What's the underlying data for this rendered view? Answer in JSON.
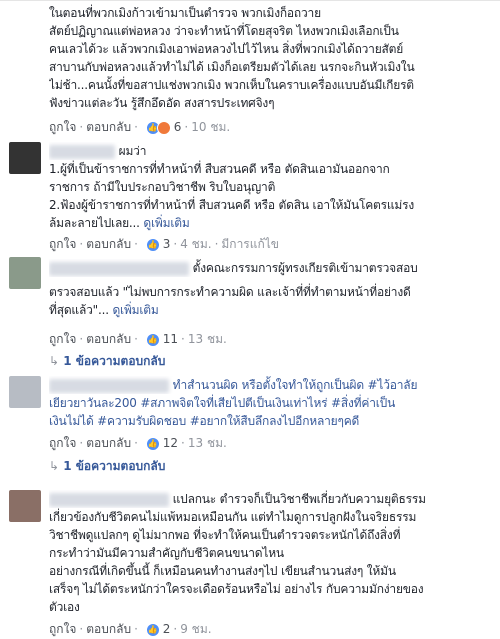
{
  "comments": [
    {
      "lines": [
        "ในตอนที่พวกเมิงก้าวเข้ามาเป็นตำรวจ พวกเมิงก็อถวาย",
        "สัตย์ปฏิญาณแต่พ่อหลวง ว่าจะทำหน้าที่โดยสุจริต ไหงพวกเมิงเลือกเป็น",
        "คนเลวได้วะ แล้วพวกเมิงเอาพ่อหลวงไปไว้ไหน สิ่งที่พวกเมิงได้ถวายสัตย์",
        "สาบานกับพ่อหลวงแล้วทำไม่ได้ เมิงก็อเตรียมตัวได้เลย นรกจะกินหัวเมิงใน",
        "ไม่ช้า...คนนั้งที่ขอสาปแช่งพวกเมิง พวกเห็บในคราบเครื่องแบบอันมีเกียรติ",
        "ฟังข่าวแต่ละวัน รู้สึกอึดอัด สงสารประเทศจิงๆ"
      ],
      "actions": {
        "like": "ถูกใจ",
        "reply": "ตอบกลับ",
        "count": "6",
        "time": "10 ชม."
      }
    },
    {
      "header_suffix": "ผมว่า",
      "lines": [
        "1.ผู้ที่เป็นข้าราชการที่ทำหน้าที่ สืบสวนคดี หรือ ตัดสินเอามันออกจาก",
        "ราชการ ถ้ามีใบประกอบวิชาชีพ ริบใบอนุญาติ",
        "2.ฟ้องผู้ข้าราชการที่ทำหน้าที่ สืบสวนคดี หรือ ตัดสิน เอาให้มันโคตรแม่รง",
        "ล้มละลายไปเลย..."
      ],
      "see_more": "ดูเพิ่มเติม",
      "actions": {
        "like": "ถูกใจ",
        "reply": "ตอบกลับ",
        "count": "3",
        "time": "4 ชม.",
        "edited": "มีการแก้ไข"
      }
    },
    {
      "header_suffix": "ตั้งคณะกรรมการผู้ทรงเกียรติเข้ามาตรวจสอบ",
      "lines": [
        "ตรวจสอบแล้ว \"ไม่พบการกระทำความผิด และเจ้าที่ที่ทำตามหน้าที่อย่างดี",
        "ที่สุดแล้ว\"..."
      ],
      "see_more": "ดูเพิ่มเติม",
      "actions": {
        "like": "ถูกใจ",
        "reply": "ตอบกลับ",
        "count": "11",
        "time": "13 ชม."
      },
      "replies": "1 ข้อความตอบกลับ"
    },
    {
      "header_suffix": "ทำสำนวนผิด หรือตั้งใจทำให้ถูกเป็นผิด #ไว้อาลัย",
      "lines": [
        "เยียวยาวันละ200 #สภาพจิตใจที่เสียไปตีเป็นเงินเท่าไหร่ #สิ่งที่ค่าเป็น",
        "เงินไม่ได้ #ความรับผิดชอบ #อยากให้สืบลึกลงไปอีกหลายๆคดี"
      ],
      "actions": {
        "like": "ถูกใจ",
        "reply": "ตอบกลับ",
        "count": "12",
        "time": "13 ชม."
      },
      "replies": "1 ข้อความตอบกลับ"
    },
    {
      "header_suffix": "แปลกนะ ตำรวจก็เป็นวิชาชีพเกี่ยวกับความยุติธรรม",
      "lines": [
        "เกี่ยวข้องกับชีวิตคนไม่แพ้หมอเหมือนกัน แต่ทำไมดูการปลูกฝังในจริยธรรม",
        "วิชาชีพดูแปลกๆ ดูไม่มากพอ ที่จะทำให้คนเป็นตำรวจตระหนักได้ถึงสิ่งที่",
        "กระทำว่ามันมีความสำคัญกับชีวิตคนขนาดไหน",
        "อย่างกรณีที่เกิดขึ้นนี้ ก็เหมือนคนทำงานส่งๆไป เขียนสำนวนส่งๆ ให้มัน",
        "เสร็จๆ ไม่ได้ตระหนักว่าใครจะเดือดร้อนหรือไม่ อย่างไร กับความมักง่ายของ",
        "ตัวเอง"
      ],
      "actions": {
        "like": "ถูกใจ",
        "reply": "ตอบกลับ",
        "count": "2",
        "time": "9 ชม."
      }
    }
  ],
  "colors": {
    "link": "#365899",
    "meta": "#90949c",
    "like": "#4f8ff7",
    "angry": "#f0793a"
  }
}
